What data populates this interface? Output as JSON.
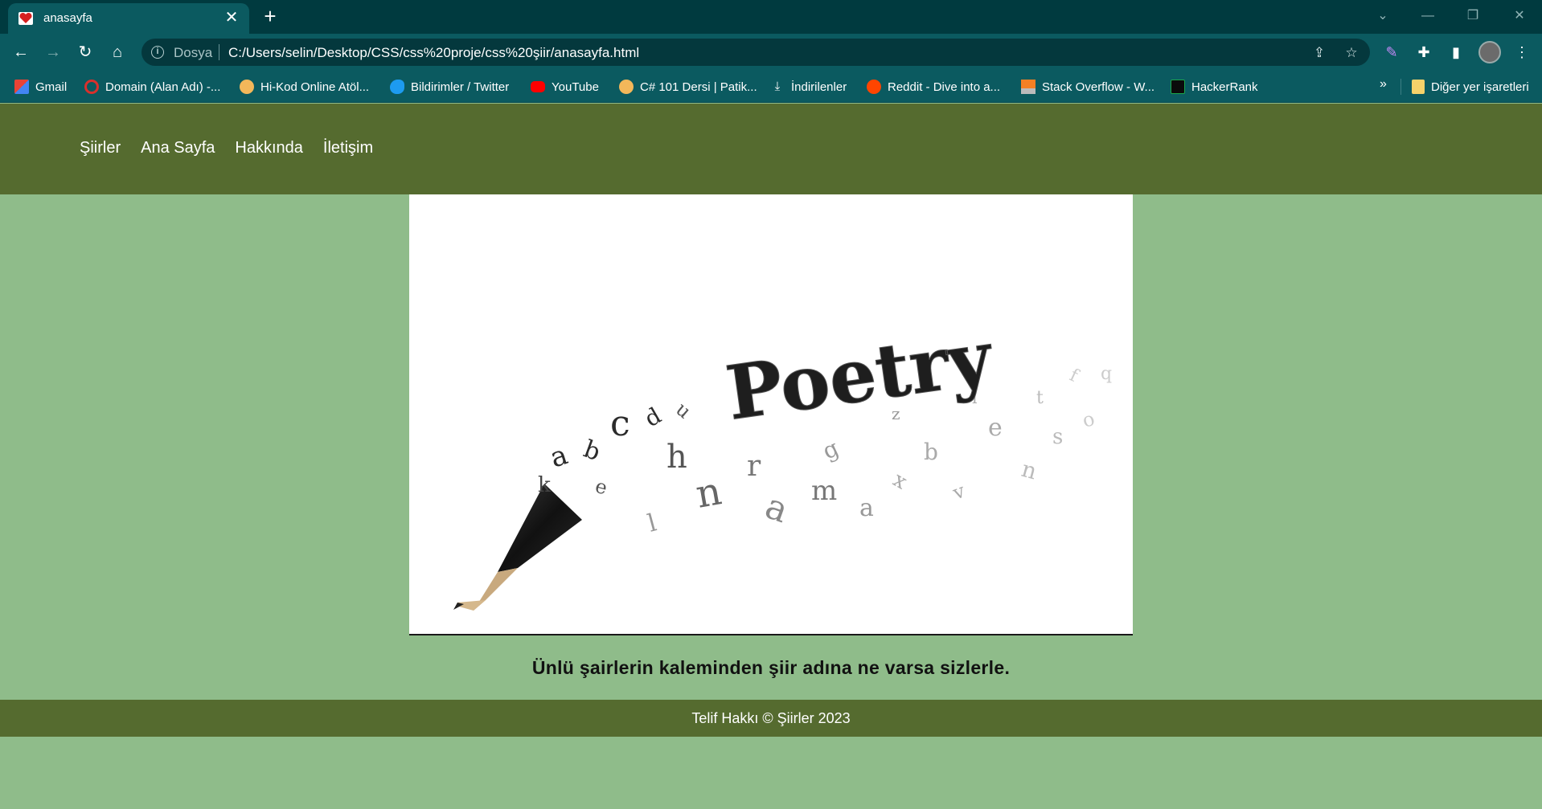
{
  "browser": {
    "tab_title": "anasayfa",
    "new_tab": "+",
    "close_tab": "✕",
    "omnibox": {
      "security_label": "Dosya",
      "url": "C:/Users/selin/Desktop/CSS/css%20proje/css%20şiir/anasayfa.html"
    },
    "bookmarks": [
      {
        "label": "Gmail",
        "icon": "gmail-icon",
        "color": "#ea4335"
      },
      {
        "label": "Domain (Alan Adı) -...",
        "icon": "domain-icon",
        "color": "#d9302c"
      },
      {
        "label": "Hi-Kod Online Atöl...",
        "icon": "hikod-icon",
        "color": "#f3b75a"
      },
      {
        "label": "Bildirimler / Twitter",
        "icon": "twitter-icon",
        "color": "#1d9bf0"
      },
      {
        "label": "YouTube",
        "icon": "youtube-icon",
        "color": "#ff0000"
      },
      {
        "label": "C# 101 Dersi | Patik...",
        "icon": "patika-icon",
        "color": "#f3b75a"
      },
      {
        "label": "İndirilenler",
        "icon": "download-icon",
        "color": "#ffffff"
      },
      {
        "label": "Reddit - Dive into a...",
        "icon": "reddit-icon",
        "color": "#ff4500"
      },
      {
        "label": "Stack Overflow - W...",
        "icon": "stackoverflow-icon",
        "color": "#f48024"
      },
      {
        "label": "HackerRank",
        "icon": "hackerrank-icon",
        "color": "#0b0b0b"
      }
    ],
    "bookmarks_overflow": "»",
    "other_bookmarks": "Diğer yer işaretleri"
  },
  "site": {
    "nav": [
      "Şiirler",
      "Ana Sayfa",
      "Hakkında",
      "İletişim"
    ],
    "hero_word": "Poetry",
    "tagline": "Ünlü şairlerin kaleminden şiir adına ne varsa sizlerle.",
    "footer": "Telif Hakkı © Şiirler 2023"
  },
  "colors": {
    "page_bg": "#8fbc8a",
    "header_footer_bg": "#556b2f",
    "browser_frame": "#003a3f",
    "browser_toolbar": "#0b5a60"
  }
}
